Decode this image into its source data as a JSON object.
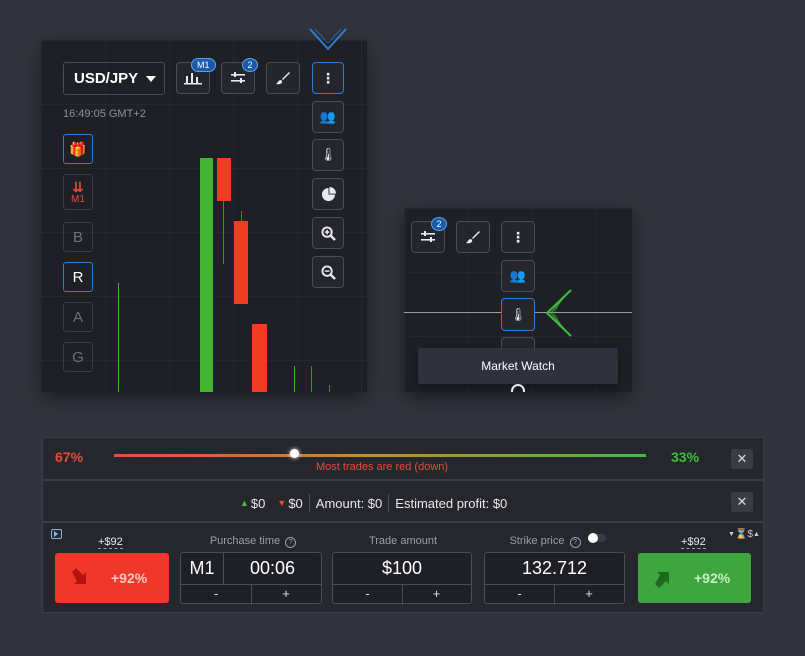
{
  "main_chart": {
    "pair": "USD/JPY",
    "time": "16:49:05 GMT+2",
    "timeframe_badge": "M1",
    "settings_badge": "2",
    "side_buttons": [
      {
        "label": "🎁",
        "name": "gift-button"
      },
      {
        "label": "⇊",
        "sub": "M1",
        "name": "trend-m1-button"
      },
      {
        "label": "B",
        "name": "indicator-b-button"
      },
      {
        "label": "R",
        "name": "indicator-r-button"
      },
      {
        "label": "A",
        "name": "indicator-a-button"
      },
      {
        "label": "G",
        "name": "indicator-g-button"
      }
    ]
  },
  "popup": {
    "settings_badge": "2",
    "tooltip": "Market Watch"
  },
  "sentiment": {
    "red_pct": "67%",
    "green_pct": "33%",
    "caption": "Most trades are red (down)",
    "slider_position": 0.34,
    "colors": {
      "red": "#e54b3c",
      "green": "#3fbd3f"
    }
  },
  "trades_bar": {
    "up_value": "$0",
    "down_value": "$0",
    "amount": "Amount: $0",
    "profit": "Estimated profit: $0"
  },
  "trade_panel": {
    "sell_payout_label": "+$92",
    "sell_percent": "+92%",
    "buy_payout_label": "+$92",
    "buy_percent": "+92%",
    "currency_toggle": "$",
    "purchase_time": {
      "label": "Purchase time",
      "tf": "M1",
      "value": "00:06",
      "minus": "-",
      "plus": "+"
    },
    "trade_amount": {
      "label": "Trade amount",
      "value": "$100",
      "minus": "-",
      "plus": "+"
    },
    "strike_price": {
      "label": "Strike price",
      "value": "132.712",
      "minus": "-",
      "plus": "+"
    },
    "colors": {
      "sell": "#f0372a",
      "buy": "#3fa53f"
    }
  }
}
